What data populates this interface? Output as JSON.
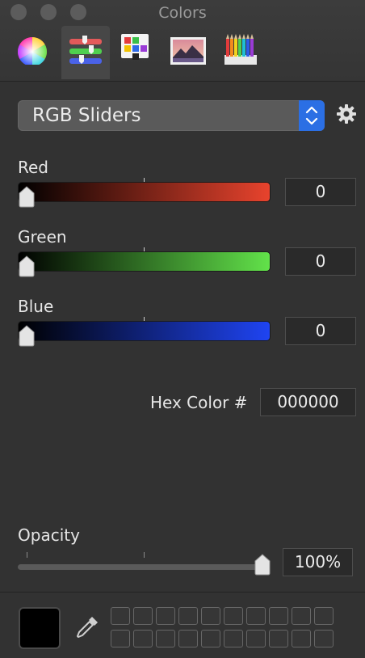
{
  "window": {
    "title": "Colors"
  },
  "toolbar": {
    "tabs": [
      {
        "name": "color-wheel",
        "icon": "color-wheel-icon",
        "active": false
      },
      {
        "name": "color-sliders",
        "icon": "sliders-icon",
        "active": true
      },
      {
        "name": "color-palettes",
        "icon": "palettes-icon",
        "active": false
      },
      {
        "name": "image-palettes",
        "icon": "image-icon",
        "active": false
      },
      {
        "name": "pencils",
        "icon": "pencils-icon",
        "active": false
      }
    ]
  },
  "mode_select": {
    "value": "RGB Sliders",
    "icon": "stepper-icon"
  },
  "settings": {
    "icon": "gear-icon"
  },
  "sliders": [
    {
      "label": "Red",
      "value": "0",
      "level": 0.0,
      "color": "#e8432d"
    },
    {
      "label": "Green",
      "value": "0",
      "level": 0.0,
      "color": "#62e24a"
    },
    {
      "label": "Blue",
      "value": "0",
      "level": 0.0,
      "color": "#1f44f2"
    }
  ],
  "hex": {
    "label": "Hex Color #",
    "value": "000000"
  },
  "opacity": {
    "label": "Opacity",
    "value": "100%",
    "level": 1.0
  },
  "current_color": {
    "hex": "#000000"
  },
  "eyedropper": {
    "icon": "eyedropper-icon"
  },
  "swatches": {
    "rows": 2,
    "cols": 10
  }
}
